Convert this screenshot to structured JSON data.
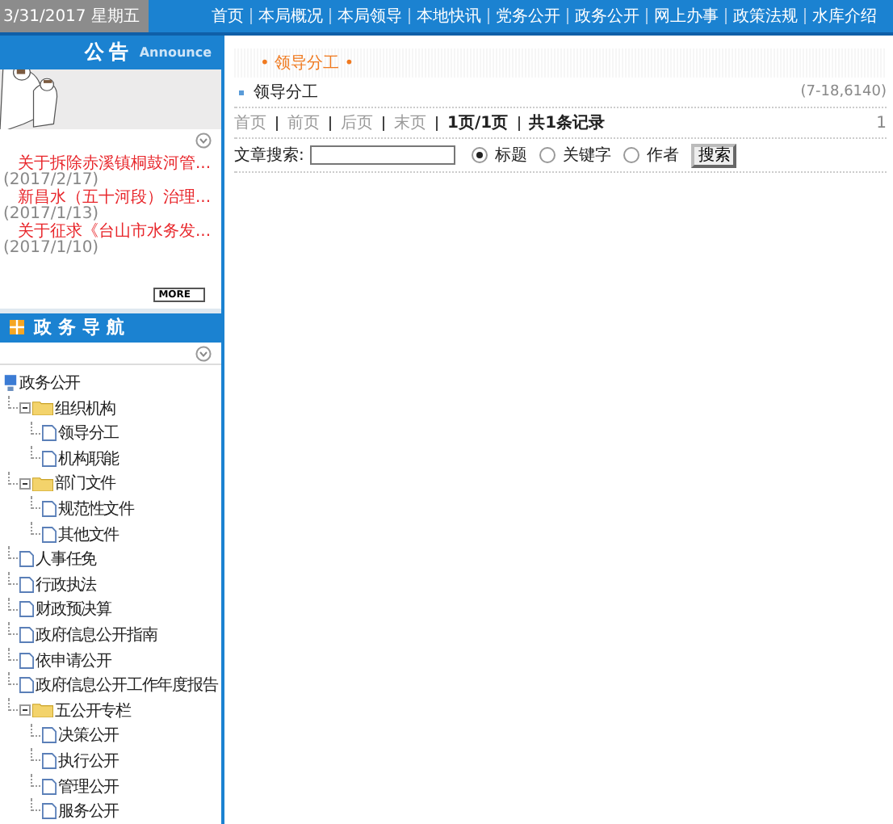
{
  "top_bar": {
    "date": "3/31/2017 星期五",
    "nav": [
      "首页",
      "本局概况",
      "本局领导",
      "本地快讯",
      "党务公开",
      "政务公开",
      "网上办事",
      "政策法规",
      "水库介绍"
    ]
  },
  "announce": {
    "title": "公告",
    "subtitle": "Announce",
    "more": "MORE",
    "items": [
      {
        "title": "关于拆除赤溪镇桐鼓河管...",
        "date": "(2017/2/17)"
      },
      {
        "title": "新昌水（五十河段）治理...",
        "date": "(2017/1/13)"
      },
      {
        "title": "关于征求《台山市水务发...",
        "date": "(2017/1/10)"
      }
    ]
  },
  "nav_panel": {
    "title": "政务导航",
    "tree": [
      {
        "label": "政务公开",
        "kind": "root",
        "children": [
          {
            "label": "组织机构",
            "kind": "folder",
            "expanded": true,
            "children": [
              {
                "label": "领导分工",
                "kind": "file"
              },
              {
                "label": "机构职能",
                "kind": "file"
              }
            ]
          },
          {
            "label": "部门文件",
            "kind": "folder",
            "expanded": true,
            "children": [
              {
                "label": "规范性文件",
                "kind": "file"
              },
              {
                "label": "其他文件",
                "kind": "file"
              }
            ]
          },
          {
            "label": "人事任免",
            "kind": "file"
          },
          {
            "label": "行政执法",
            "kind": "file"
          },
          {
            "label": "财政预决算",
            "kind": "file"
          },
          {
            "label": "政府信息公开指南",
            "kind": "file"
          },
          {
            "label": "依申请公开",
            "kind": "file"
          },
          {
            "label": "政府信息公开工作年度报告",
            "kind": "file"
          },
          {
            "label": "五公开专栏",
            "kind": "folder",
            "expanded": true,
            "children": [
              {
                "label": "决策公开",
                "kind": "file"
              },
              {
                "label": "执行公开",
                "kind": "file"
              },
              {
                "label": "管理公开",
                "kind": "file"
              },
              {
                "label": "服务公开",
                "kind": "file"
              }
            ]
          }
        ]
      }
    ]
  },
  "breadcrumb": "• 领导分工 •",
  "articles": [
    {
      "title": "领导分工",
      "meta": "(7-18,6140)"
    }
  ],
  "pager": {
    "items": [
      {
        "label": "首页",
        "kind": "link",
        "disabled": true
      },
      {
        "label": "前页",
        "kind": "link",
        "disabled": true
      },
      {
        "label": "后页",
        "kind": "link",
        "disabled": true
      },
      {
        "label": "末页",
        "kind": "link",
        "disabled": true
      },
      {
        "label": "1页/1页",
        "kind": "info"
      },
      {
        "label": "共1条记录",
        "kind": "info"
      }
    ],
    "page": "1"
  },
  "search": {
    "label": "文章搜索:",
    "options": [
      {
        "label": "标题",
        "selected": true
      },
      {
        "label": "关键字",
        "selected": false
      },
      {
        "label": "作者",
        "selected": false
      }
    ],
    "button": "搜索"
  }
}
